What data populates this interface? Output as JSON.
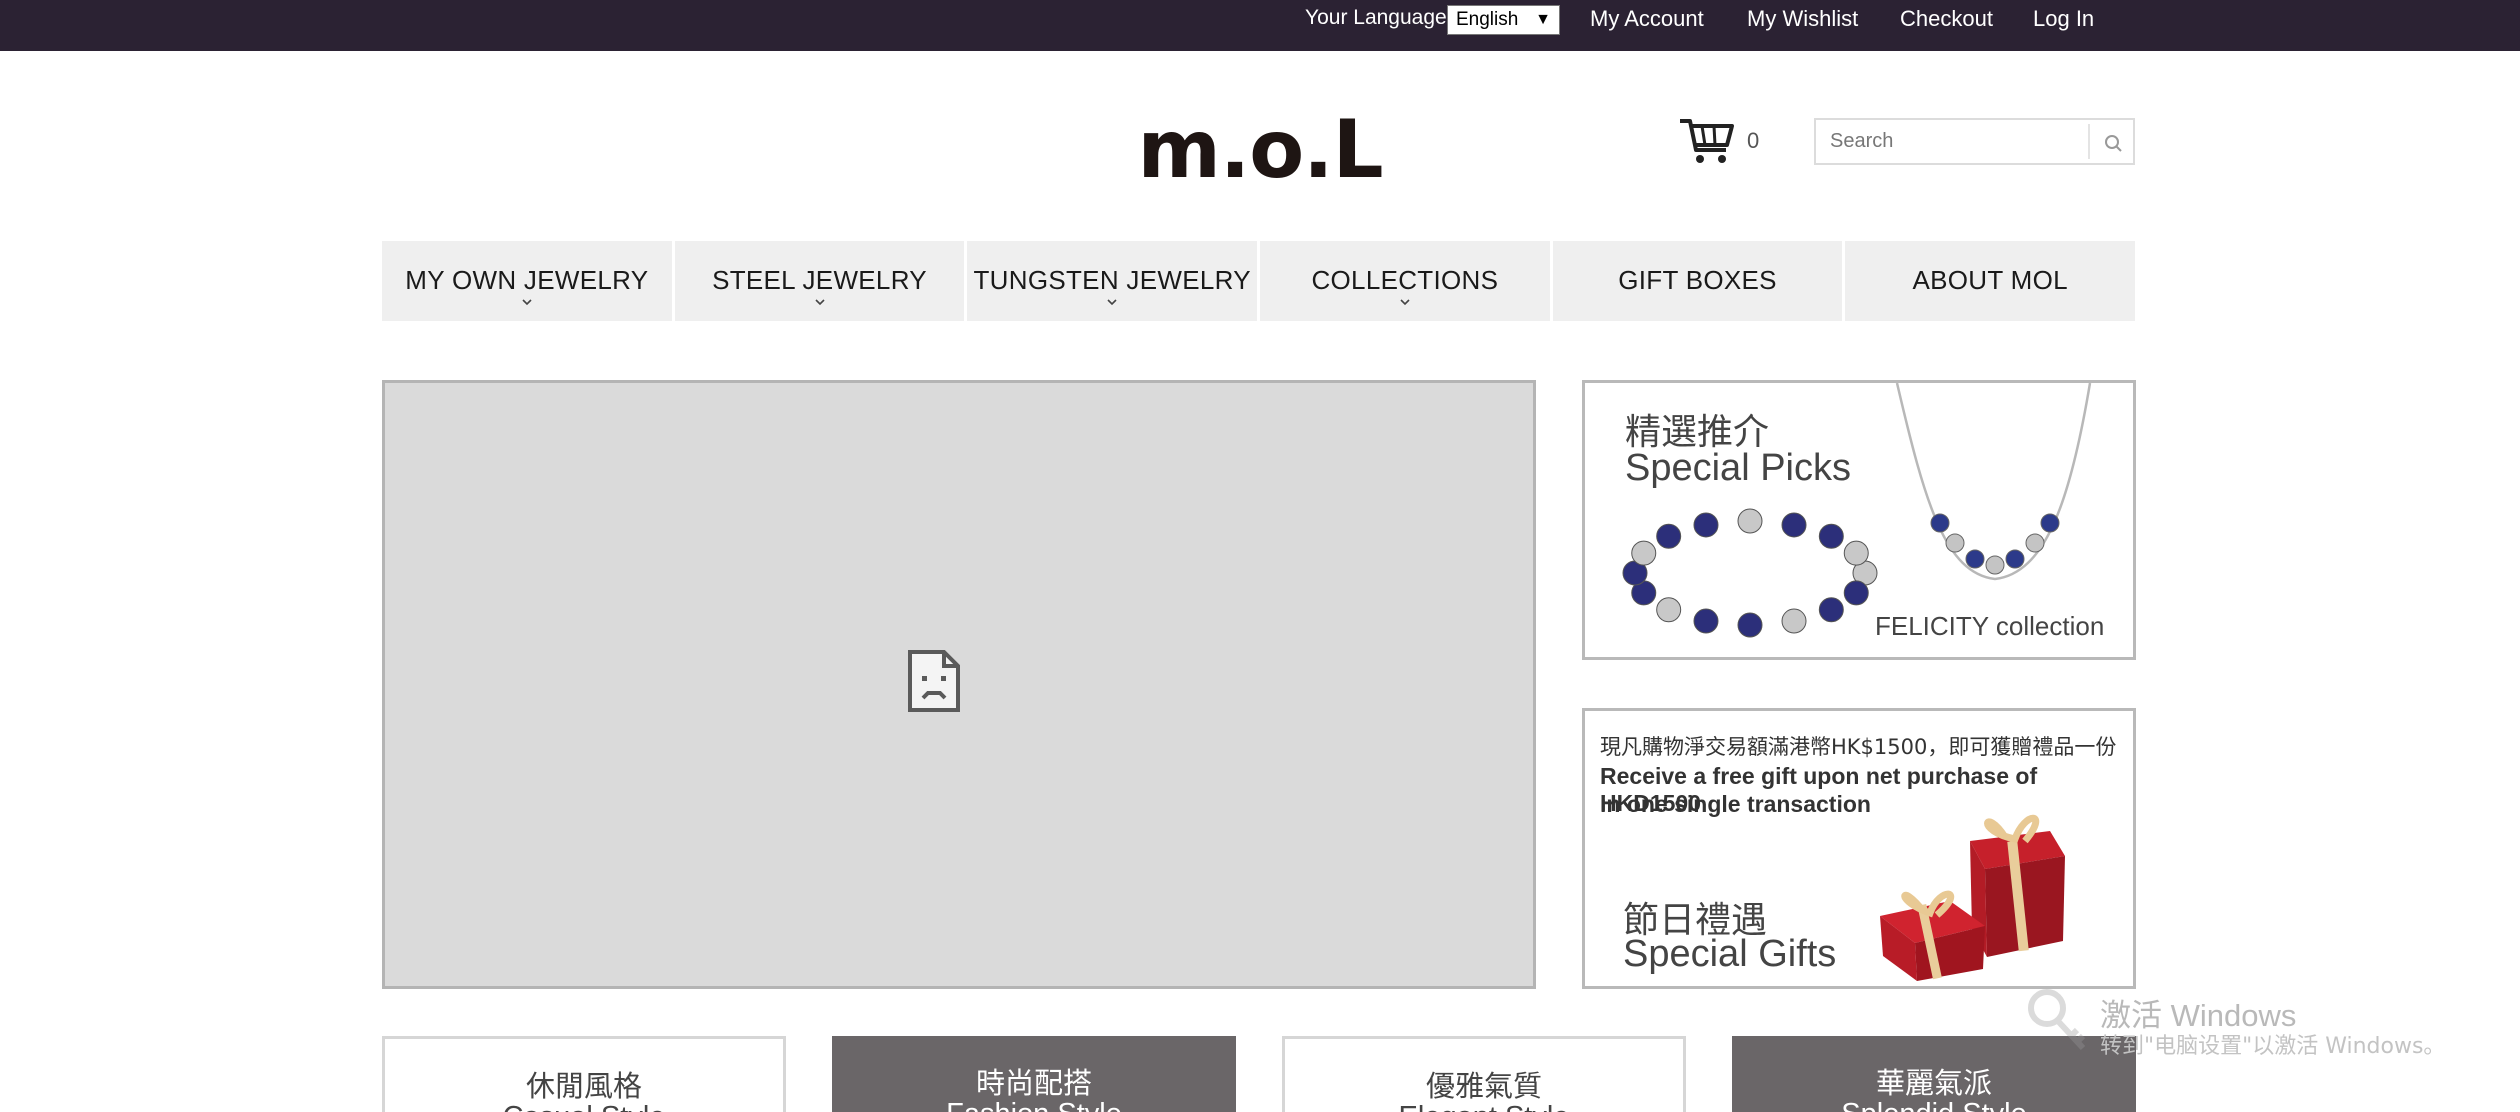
{
  "topbar": {
    "language_label": "Your Language:",
    "language_value": "English",
    "links": [
      "My Account",
      "My Wishlist",
      "Checkout",
      "Log In"
    ]
  },
  "header": {
    "logo_text": "m.o.L",
    "cart_count": "0",
    "search_placeholder": "Search"
  },
  "nav": {
    "items": [
      {
        "label": "MY OWN JEWELRY",
        "has_dropdown": true
      },
      {
        "label": "STEEL JEWELRY",
        "has_dropdown": true
      },
      {
        "label": "TUNGSTEN JEWELRY",
        "has_dropdown": true
      },
      {
        "label": "COLLECTIONS",
        "has_dropdown": true
      },
      {
        "label": "GIFT BOXES",
        "has_dropdown": false
      },
      {
        "label": "ABOUT MOL",
        "has_dropdown": false
      }
    ]
  },
  "promos": {
    "picks": {
      "title_cn": "精選推介",
      "title_en": "Special Picks",
      "collection": "FELICITY collection"
    },
    "gifts": {
      "notice_cn": "現凡購物淨交易額滿港幣HK$1500，即可獲贈禮品一份",
      "notice_en_line1": "Receive a free gift upon net purchase of HKD1500",
      "notice_en_line2": "in one single transaction",
      "title_cn": "節日禮遇",
      "title_en": "Special Gifts"
    }
  },
  "tiles": [
    {
      "cn": "休閒風格",
      "en": "Casual Style"
    },
    {
      "cn": "時尚配搭",
      "en": "Fashion Style"
    },
    {
      "cn": "優雅氣質",
      "en": "Elegant Style"
    },
    {
      "cn": "華麗氣派",
      "en": "Splendid Style"
    }
  ],
  "watermark": {
    "title": "激活 Windows",
    "subtitle": "转到\"电脑设置\"以激活 Windows。"
  },
  "colors": {
    "topbar_bg": "#2b2233",
    "nav_bg": "#efefef",
    "slider_bg": "#dadada",
    "tile_dark": "#6a6668"
  }
}
